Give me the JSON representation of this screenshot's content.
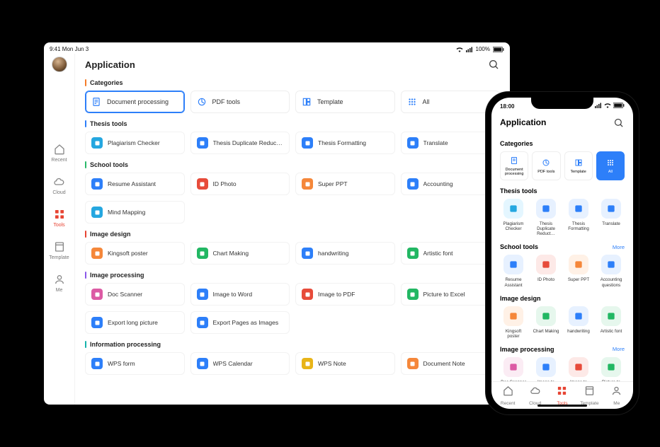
{
  "tablet": {
    "status_left": "9:41  Mon Jun 3",
    "status_battery": "100%",
    "title": "Application",
    "sidebar": [
      {
        "id": "recent",
        "label": "Recent"
      },
      {
        "id": "cloud",
        "label": "Cloud"
      },
      {
        "id": "tools",
        "label": "Tools"
      },
      {
        "id": "template",
        "label": "Template"
      },
      {
        "id": "me",
        "label": "Me"
      }
    ],
    "sections": {
      "categories_label": "Categories",
      "categories": [
        {
          "label": "Document processing"
        },
        {
          "label": "PDF tools"
        },
        {
          "label": "Template"
        },
        {
          "label": "All"
        }
      ],
      "thesis_label": "Thesis tools",
      "thesis": [
        {
          "label": "Plagiarism Checker",
          "c": "sb-cyan"
        },
        {
          "label": "Thesis Duplicate Reduct…",
          "c": "sb-blue"
        },
        {
          "label": "Thesis Formatting",
          "c": "sb-blue"
        },
        {
          "label": "Translate",
          "c": "sb-blue"
        }
      ],
      "school_label": "School tools",
      "school_row1": [
        {
          "label": "Resume Assistant",
          "c": "sb-blue"
        },
        {
          "label": "ID Photo",
          "c": "sb-red"
        },
        {
          "label": "Super PPT",
          "c": "sb-orange"
        },
        {
          "label": "Accounting",
          "c": "sb-blue"
        }
      ],
      "school_row2": [
        {
          "label": "Mind Mapping",
          "c": "sb-cyan"
        }
      ],
      "image_design_label": "Image design",
      "image_design": [
        {
          "label": "Kingsoft  poster",
          "c": "sb-orange"
        },
        {
          "label": "Chart Making",
          "c": "sb-green"
        },
        {
          "label": "handwriting",
          "c": "sb-blue"
        },
        {
          "label": "Artistic font",
          "c": "sb-green"
        }
      ],
      "image_proc_label": "Image processing",
      "image_proc_row1": [
        {
          "label": "Doc Scanner",
          "c": "sb-pink"
        },
        {
          "label": "Image to Word",
          "c": "sb-blue"
        },
        {
          "label": "Image to PDF",
          "c": "sb-red"
        },
        {
          "label": "Picture to Excel",
          "c": "sb-green"
        }
      ],
      "image_proc_row2": [
        {
          "label": "Export long picture",
          "c": "sb-blue"
        },
        {
          "label": "Export Pages as Images",
          "c": "sb-blue"
        }
      ],
      "info_proc_label": "Information processing",
      "info_proc": [
        {
          "label": "WPS form",
          "c": "sb-blue"
        },
        {
          "label": "WPS Calendar",
          "c": "sb-blue"
        },
        {
          "label": "WPS Note",
          "c": "sb-yellow"
        },
        {
          "label": "Document Note",
          "c": "sb-orange"
        }
      ]
    }
  },
  "phone": {
    "status_time": "18:00",
    "title": "Application",
    "categories_label": "Categories",
    "categories": [
      {
        "label": "Document processing"
      },
      {
        "label": "PDF tools"
      },
      {
        "label": "Template"
      },
      {
        "label": "All"
      }
    ],
    "more": "More",
    "thesis_label": "Thesis tools",
    "thesis": [
      {
        "label": "Plagiarism Checker",
        "c": "bg-cyan"
      },
      {
        "label": "Thesis Duplicate Reduct…",
        "c": "bg-blue"
      },
      {
        "label": "Thesis Formatting",
        "c": "bg-blue"
      },
      {
        "label": "Translate",
        "c": "bg-blue"
      }
    ],
    "school_label": "School tools",
    "school": [
      {
        "label": "Resume Assistant",
        "c": "bg-blue"
      },
      {
        "label": "ID Photo",
        "c": "bg-red"
      },
      {
        "label": "Super PPT",
        "c": "bg-orange"
      },
      {
        "label": "Accounting questions",
        "c": "bg-blue"
      }
    ],
    "image_design_label": "Image design",
    "image_design": [
      {
        "label": "Kingsoft  poster",
        "c": "bg-orange"
      },
      {
        "label": "Chart Making",
        "c": "bg-green"
      },
      {
        "label": "handwriting",
        "c": "bg-blue"
      },
      {
        "label": "Artistic font",
        "c": "bg-green"
      }
    ],
    "image_proc_label": "Image processing",
    "image_proc": [
      {
        "label": "Doc Scanner",
        "c": "bg-pink"
      },
      {
        "label": "Image to Word",
        "c": "bg-blue"
      },
      {
        "label": "Image to PDF",
        "c": "bg-red"
      },
      {
        "label": "Picture to Excel",
        "c": "bg-green"
      }
    ],
    "tabs": [
      {
        "id": "recent",
        "label": "Recent"
      },
      {
        "id": "cloud",
        "label": "Cloud"
      },
      {
        "id": "tools",
        "label": "Tools"
      },
      {
        "id": "template",
        "label": "Template"
      },
      {
        "id": "me",
        "label": "Me"
      }
    ]
  }
}
